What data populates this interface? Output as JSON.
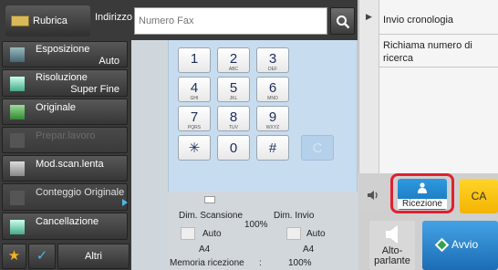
{
  "header": {
    "rubrica_label": "Rubrica",
    "indirizzo_label": "Indirizzo",
    "fax_placeholder": "Numero Fax"
  },
  "right_panel": {
    "items": [
      "Invio cronologia",
      "Richiama numero di ricerca"
    ]
  },
  "menu": {
    "items": [
      {
        "label": "Esposizione",
        "value": "Auto",
        "icon": "exposure-icon",
        "enabled": true
      },
      {
        "label": "Risoluzione",
        "value": "Super Fine",
        "icon": "resolution-icon",
        "enabled": true
      },
      {
        "label": "Originale",
        "value": "",
        "icon": "original-icon",
        "enabled": true
      },
      {
        "label": "Prepar.lavoro",
        "value": "",
        "icon": "job-prep-icon",
        "enabled": false
      },
      {
        "label": "Mod.scan.lenta",
        "value": "",
        "icon": "slow-scan-icon",
        "enabled": true
      },
      {
        "label": "Conteggio Originale",
        "value": "",
        "icon": "count-icon",
        "enabled": false
      },
      {
        "label": "Cancellazione",
        "value": "",
        "icon": "erase-icon",
        "enabled": true
      }
    ],
    "altri_label": "Altri"
  },
  "keypad": {
    "keys": [
      {
        "num": "1",
        "sub": ""
      },
      {
        "num": "2",
        "sub": "ABC"
      },
      {
        "num": "3",
        "sub": "DEF"
      },
      {
        "num": "4",
        "sub": "GHI"
      },
      {
        "num": "5",
        "sub": "JKL"
      },
      {
        "num": "6",
        "sub": "MNO"
      },
      {
        "num": "7",
        "sub": "PQRS"
      },
      {
        "num": "8",
        "sub": "TUV"
      },
      {
        "num": "9",
        "sub": "WXYZ"
      },
      {
        "num": "✳",
        "sub": ""
      },
      {
        "num": "0",
        "sub": ""
      },
      {
        "num": "#",
        "sub": ""
      }
    ],
    "clear_label": "C"
  },
  "info": {
    "dim_scansione_label": "Dim. Scansione",
    "dim_invio_label": "Dim. Invio",
    "ratio": "100%",
    "scan_auto": "Auto",
    "send_auto": "Auto",
    "scan_size": "A4",
    "send_size": "A4",
    "memoria_label": "Memoria ricezione",
    "memoria_sep": ":",
    "memoria_value": "100%"
  },
  "actions": {
    "ricezione_label": "Ricezione",
    "ca_label": "CA",
    "altoparlante_label": "Alto-\nparlante",
    "avvio_label": "Avvio"
  },
  "colors": {
    "accent_blue": "#1b6db4",
    "highlight_red": "#e02030",
    "ca_yellow": "#f4b400"
  }
}
